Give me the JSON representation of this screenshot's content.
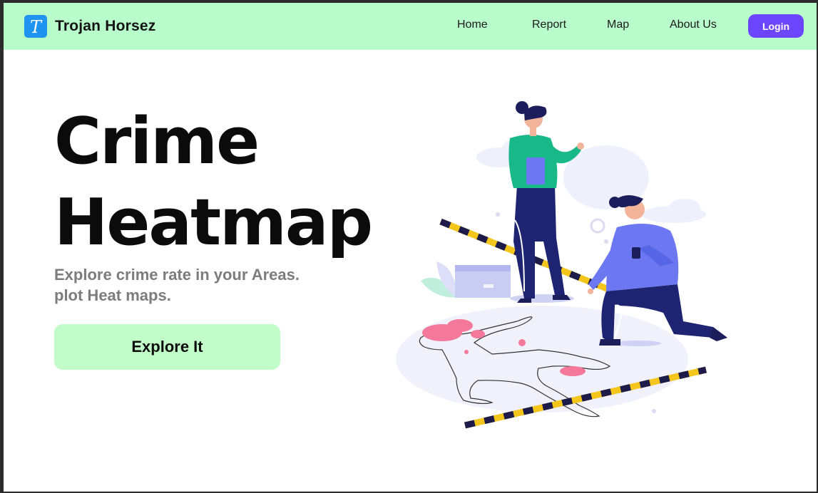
{
  "brand": {
    "logo_letter": "T",
    "name": "Trojan Horsez"
  },
  "nav": {
    "items": [
      {
        "label": "Home"
      },
      {
        "label": "Report"
      },
      {
        "label": "Map"
      },
      {
        "label": "About Us"
      }
    ],
    "login_label": "Login"
  },
  "hero": {
    "title_line1": "Crime",
    "title_line2": "Heatmap",
    "subtitle_line1": "Explore crime rate in your Areas.",
    "subtitle_line2": "plot Heat maps.",
    "cta_label": "Explore It"
  },
  "colors": {
    "navbar_bg": "#b9fccc",
    "logo_bg": "#1f93f0",
    "login_bg": "#6c46ff",
    "cta_bg": "#c2fdc9",
    "subtitle": "#7c7c7c"
  },
  "illustration": {
    "icon": "crime-scene-illustration"
  }
}
